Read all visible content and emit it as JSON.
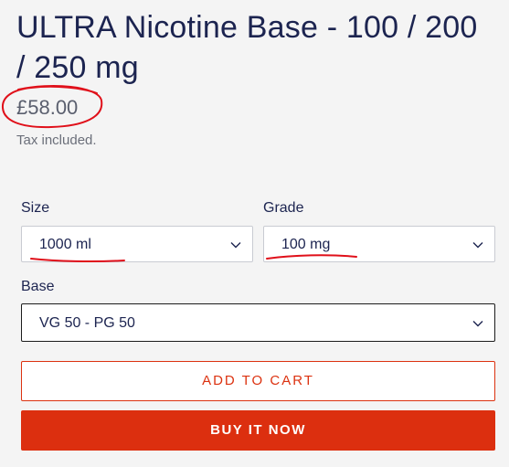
{
  "product": {
    "title": "ULTRA Nicotine Base - 100 / 200 / 250 mg",
    "price": "£58.00",
    "tax_note": "Tax included."
  },
  "options": {
    "size": {
      "label": "Size",
      "value": "1000 ml"
    },
    "grade": {
      "label": "Grade",
      "value": "100 mg"
    },
    "base": {
      "label": "Base",
      "value": "VG 50 - PG 50"
    }
  },
  "actions": {
    "add_to_cart": "ADD TO CART",
    "buy_now": "BUY IT NOW"
  },
  "colors": {
    "accent": "#dc2f0f",
    "annotation": "#e0101a",
    "text": "#1c2450"
  },
  "icons": {
    "select_arrow": "chevron-down-icon"
  }
}
